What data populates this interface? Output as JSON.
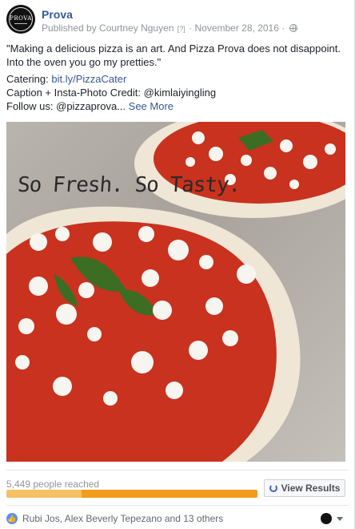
{
  "page": {
    "name": "Prova",
    "avatar_text": "PROVA",
    "published_by": "Published by Courtney Nguyen",
    "info_marker": "[?]",
    "separator": "·",
    "date": "November 28, 2016",
    "separator2": "·"
  },
  "post": {
    "quote": "\"Making a delicious pizza is an art. And Pizza Prova does not disappoint. Into the oven you go my pretties.\"",
    "catering_label": "Catering: ",
    "catering_link": "bit.ly/PizzaCater",
    "caption_line": "Caption + Insta-Photo Credit: @kimlaiyingling",
    "follow_line": "Follow us: @pizzaprova... ",
    "see_more": "See More"
  },
  "photo": {
    "overlay_text": "So Fresh. So Tasty.",
    "colors": {
      "sauce": "#c8321e",
      "crust": "#efe6d6",
      "cheese": "#f7f5f0",
      "basil": "#3b6e22"
    }
  },
  "reach": {
    "text": "5,449 people reached",
    "organic_fraction": 0.3,
    "paid_fraction": 0.7,
    "button_label": "View Results",
    "button_icon": "refresh-icon"
  },
  "footer": {
    "likers": "Rubi Jos, Alex Beverly Tepezano and 13 others",
    "like_icon": "thumbs-up-icon",
    "like_glyph": "👍"
  },
  "colors": {
    "link": "#365899",
    "meta": "#90949c",
    "bar_organic": "#f7c063",
    "bar_paid": "#f29b1d"
  }
}
